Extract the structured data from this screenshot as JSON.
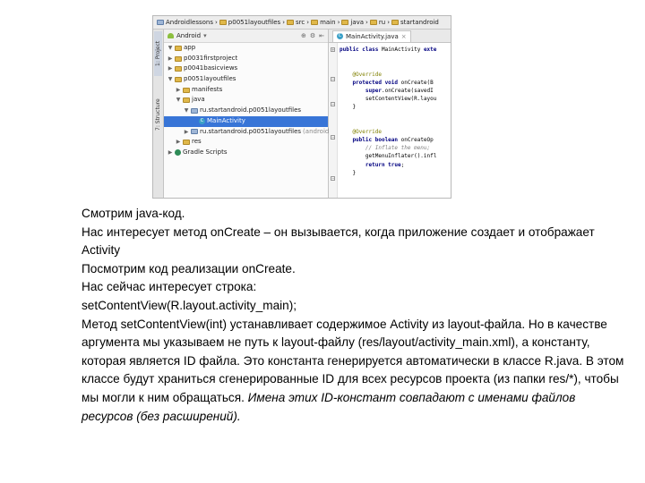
{
  "ide": {
    "breadcrumbs": [
      "Androidlessons",
      "p0051layoutfiles",
      "src",
      "main",
      "java",
      "ru",
      "startandroid"
    ],
    "side_tabs": {
      "project": "1: Project",
      "structure": "7: Structure"
    },
    "project_view": "Android",
    "tree": [
      {
        "label": "app",
        "indent": 0,
        "arrow": "▼",
        "icon": "folder"
      },
      {
        "label": "p0031firstproject",
        "indent": 0,
        "arrow": "▶",
        "icon": "folder"
      },
      {
        "label": "p0041basicviews",
        "indent": 0,
        "arrow": "▶",
        "icon": "folder"
      },
      {
        "label": "p0051layoutfiles",
        "indent": 0,
        "arrow": "▼",
        "icon": "folder"
      },
      {
        "label": "manifests",
        "indent": 1,
        "arrow": "▶",
        "icon": "folder"
      },
      {
        "label": "java",
        "indent": 1,
        "arrow": "▼",
        "icon": "folder"
      },
      {
        "label": "ru.startandroid.p0051layoutfiles",
        "indent": 2,
        "arrow": "▼",
        "icon": "package"
      },
      {
        "label": "MainActivity",
        "indent": 3,
        "arrow": "",
        "icon": "class",
        "selected": true
      },
      {
        "label": "ru.startandroid.p0051layoutfiles",
        "suffix": "(androidTest)",
        "indent": 2,
        "arrow": "▶",
        "icon": "package"
      },
      {
        "label": "res",
        "indent": 1,
        "arrow": "▶",
        "icon": "folder"
      },
      {
        "label": "Gradle Scripts",
        "indent": 0,
        "arrow": "▶",
        "icon": "gradle"
      }
    ],
    "editor_tab": "MainActivity.java",
    "code_lines": [
      {
        "parts": [
          {
            "t": "public class ",
            "c": "kw"
          },
          {
            "t": "MainActivity ",
            "c": ""
          },
          {
            "t": "exte",
            "c": "kw"
          }
        ]
      },
      {
        "parts": []
      },
      {
        "parts": []
      },
      {
        "parts": [
          {
            "t": "    @Override",
            "c": "ann"
          }
        ]
      },
      {
        "parts": [
          {
            "t": "    protected void ",
            "c": "kw"
          },
          {
            "t": "onCreate(B",
            "c": ""
          }
        ]
      },
      {
        "parts": [
          {
            "t": "        super",
            "c": "kw"
          },
          {
            "t": ".onCreate(savedI",
            "c": ""
          }
        ]
      },
      {
        "parts": [
          {
            "t": "        setContentView(R.layou",
            "c": ""
          }
        ]
      },
      {
        "parts": [
          {
            "t": "    }",
            "c": ""
          }
        ]
      },
      {
        "parts": []
      },
      {
        "parts": []
      },
      {
        "parts": [
          {
            "t": "    @Override",
            "c": "ann"
          }
        ]
      },
      {
        "parts": [
          {
            "t": "    public boolean ",
            "c": "kw"
          },
          {
            "t": "onCreateOp",
            "c": ""
          }
        ]
      },
      {
        "parts": [
          {
            "t": "        // Inflate the menu;",
            "c": "cm"
          }
        ]
      },
      {
        "parts": [
          {
            "t": "        getMenuInflater().infl",
            "c": ""
          }
        ]
      },
      {
        "parts": [
          {
            "t": "        return true",
            "c": "kw"
          },
          {
            "t": ";",
            "c": ""
          }
        ]
      },
      {
        "parts": [
          {
            "t": "    }",
            "c": ""
          }
        ]
      }
    ]
  },
  "description": {
    "lines": [
      "Смотрим java-код.",
      "Нас интересует метод onCreate – он вызывается, когда приложение создает и отображает Activity",
      "Посмотрим код реализации onCreate.",
      "Нас сейчас интересует строка:",
      "setContentView(R.layout.activity_main);",
      "Метод setContentView(int) устанавливает содержимое Activity из layout-файла. Но в качестве аргумента мы указываем не путь к layout-файлу (res/layout/activity_main.xml), а константу, которая является ID файла. Это константа генерируется автоматически в классе R.java. В этом классе будут храниться сгенерированные ID для всех ресурсов проекта (из папки res/*), чтобы мы могли к ним обращаться."
    ],
    "italic_tail": "Имена этих ID-констант совпадают с именами файлов ресурсов (без расширений)."
  }
}
